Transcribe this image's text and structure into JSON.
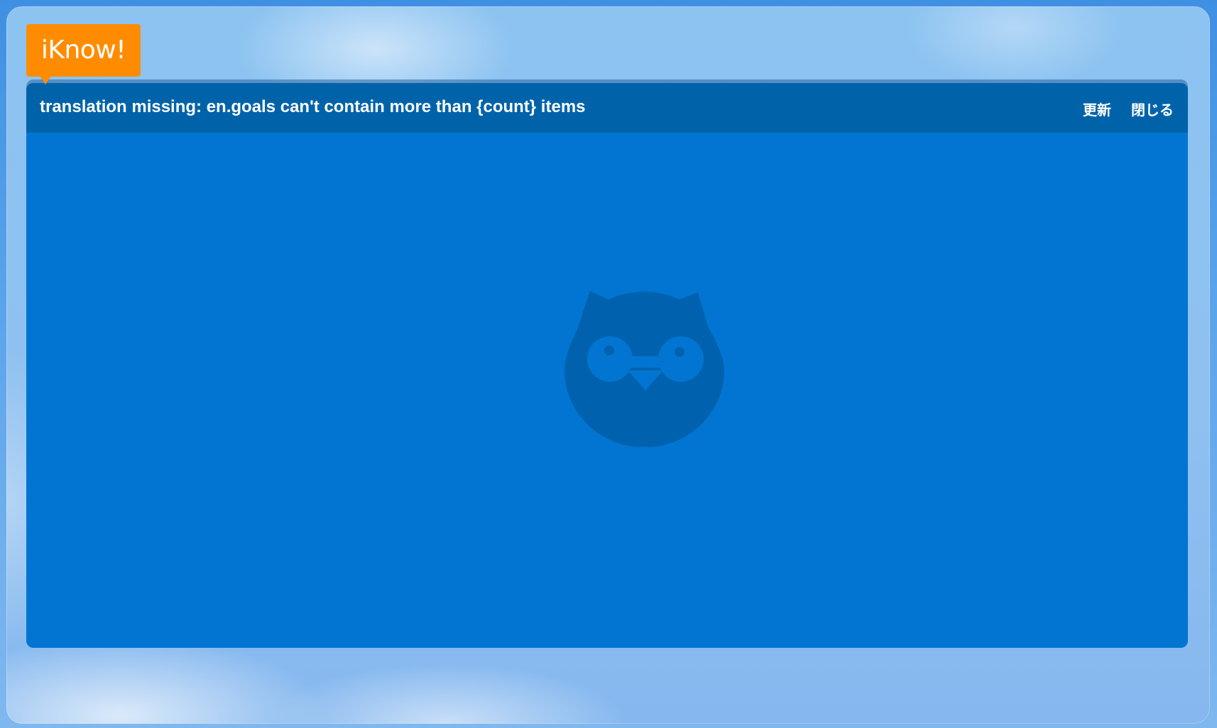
{
  "app": {
    "logo_text": "iKnow!",
    "accent_color": "#ff8c00"
  },
  "panel": {
    "title": "translation missing: en.goals can't contain more than {count} items",
    "actions": {
      "refresh_label": "更新",
      "close_label": "閉じる"
    },
    "background_color": "#0175d1",
    "header_color": "#0063aa"
  },
  "icons": {
    "placeholder": "owl-icon"
  }
}
